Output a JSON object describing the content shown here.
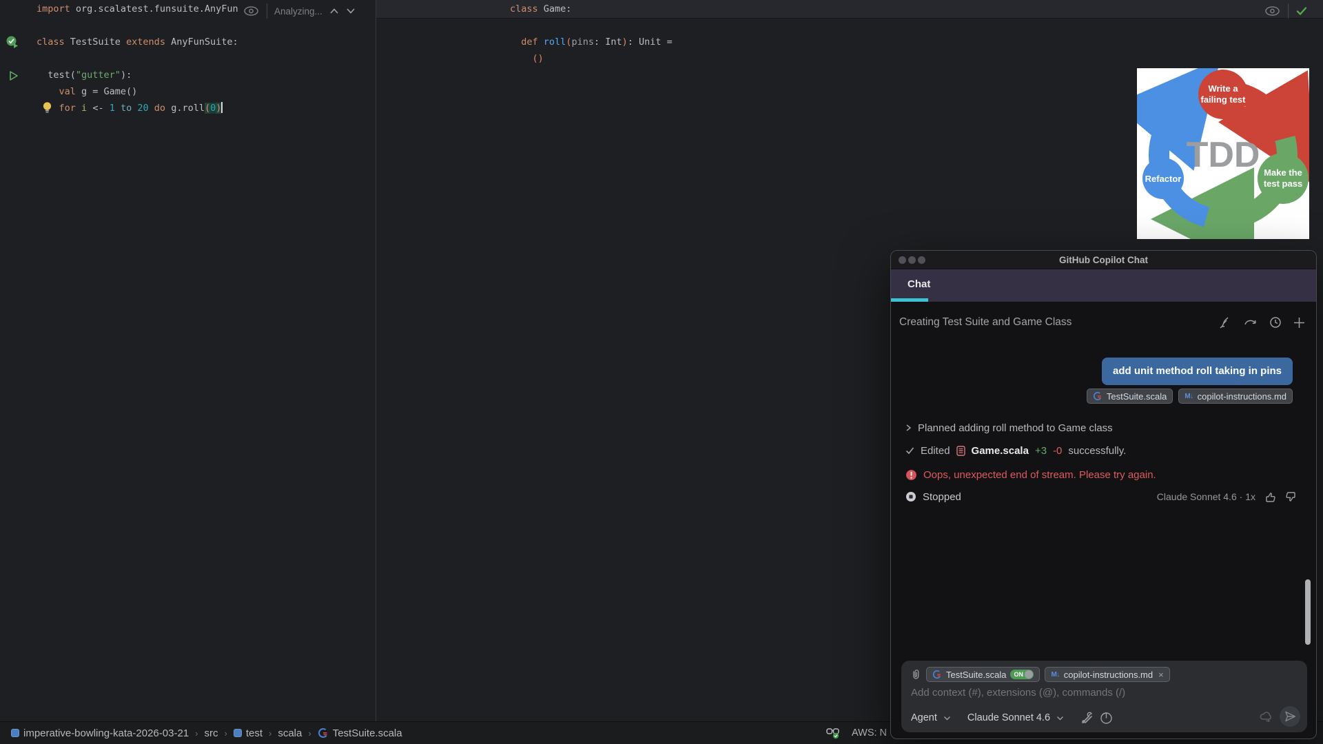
{
  "left_editor": {
    "analysis_status": "Analyzing...",
    "lines": [
      [
        [
          "import",
          "k"
        ],
        [
          " org.scalatest.funsuite.AnyFun",
          "p"
        ]
      ],
      [],
      [
        [
          "class",
          "k"
        ],
        [
          " TestSuite ",
          "p"
        ],
        [
          "extends",
          "k"
        ],
        [
          " AnyFunSuite:",
          "p"
        ]
      ],
      [],
      [
        [
          "  test(",
          "p"
        ],
        [
          "\"gutter\"",
          "s"
        ],
        [
          "):",
          "p"
        ]
      ],
      [
        [
          "    ",
          "p"
        ],
        [
          "val",
          "k"
        ],
        [
          " g = Game()",
          "p"
        ]
      ],
      [
        [
          "    ",
          "p"
        ],
        [
          "for",
          "k"
        ],
        [
          " ",
          "p"
        ],
        [
          "i",
          "v"
        ],
        [
          " <- ",
          "p"
        ],
        [
          "1",
          "n"
        ],
        [
          " ",
          "p"
        ],
        [
          "to",
          "t"
        ],
        [
          " ",
          "p"
        ],
        [
          "20",
          "n"
        ],
        [
          " ",
          "p"
        ],
        [
          "do",
          "k"
        ],
        [
          " g.roll",
          "p"
        ],
        [
          "(",
          "hl"
        ],
        [
          "0",
          "hn"
        ],
        [
          ")",
          "hl"
        ],
        [
          "",
          "caret"
        ]
      ]
    ],
    "gutter_icons": [
      "test-passed-run-icon",
      "run-test-icon",
      "intention-bulb-icon"
    ]
  },
  "right_editor": {
    "lines": [
      [
        [
          "class",
          "k"
        ],
        [
          " Game:",
          "p"
        ]
      ],
      [],
      [
        [
          "  ",
          "p"
        ],
        [
          "def",
          "k"
        ],
        [
          " ",
          "p"
        ],
        [
          "roll",
          "fn"
        ],
        [
          "(",
          "pa"
        ],
        [
          "pins",
          "pr"
        ],
        [
          ": Int",
          "p"
        ],
        [
          ")",
          "pa"
        ],
        [
          ": Unit =",
          "p"
        ]
      ],
      [
        [
          "    ()",
          "pa"
        ]
      ]
    ],
    "widget_icons": [
      "eye-icon",
      "inspections-ok-check-icon"
    ]
  },
  "tdd_diagram": {
    "center_label": "TDD",
    "steps": [
      {
        "line1": "Write a",
        "line2": "failing test",
        "color": "#cc4437"
      },
      {
        "line1": "Make the",
        "line2": "test pass",
        "color": "#6aa767"
      },
      {
        "line1": "Refactor",
        "line2": "",
        "color": "#4b90e2"
      }
    ]
  },
  "chat": {
    "window_title": "GitHub Copilot Chat",
    "tab_label": "Chat",
    "thread_title": "Creating Test Suite and Game Class",
    "header_icons": [
      "pen-scribble-icon",
      "redo-icon",
      "history-icon",
      "new-chat-icon"
    ],
    "user_message": "add unit method roll taking in pins",
    "message_chips": [
      "TestSuite.scala",
      "copilot-instructions.md"
    ],
    "steps": {
      "planned": "Planned adding roll method to Game class",
      "edited_prefix": "Edited",
      "edited_file": "Game.scala",
      "added": "+3",
      "removed": "-0",
      "edited_suffix": "successfully.",
      "error": "Oops, unexpected end of stream. Please try again.",
      "stopped": "Stopped",
      "model_usage": "Claude Sonnet 4.6 · 1x"
    },
    "input": {
      "attachment_1": "TestSuite.scala",
      "attachment_1_toggle": "ON",
      "attachment_2": "copilot-instructions.md",
      "attachment_2_close": "×",
      "placeholder": "Add context (#), extensions (@), commands (/)",
      "mode": "Agent",
      "model": "Claude Sonnet 4.6"
    }
  },
  "status_bar": {
    "breadcrumbs": [
      "imperative-bowling-kata-2026-03-21",
      "src",
      "test",
      "scala",
      "TestSuite.scala"
    ],
    "separator": "›",
    "aws_label": "AWS: N"
  },
  "colors": {
    "accent_teal": "#3ec1d5",
    "bubble_blue": "#3a689f",
    "error_red": "#dd5a5f",
    "added_green": "#5fae66",
    "removed_red": "#e0605c",
    "on_green": "#4f9a55",
    "keyword_orange": "#cf8e6d",
    "string_green": "#6aab73",
    "number_cyan": "#2aacb8"
  }
}
